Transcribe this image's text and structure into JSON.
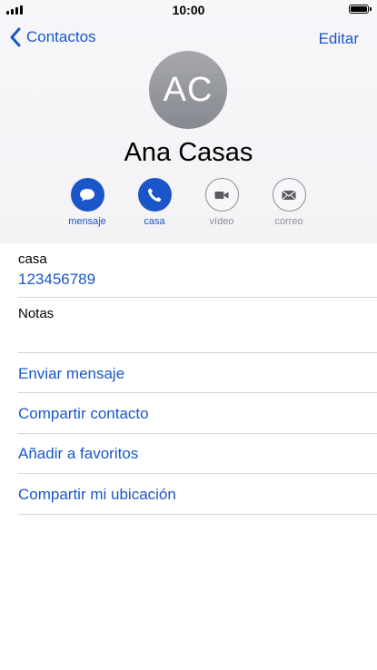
{
  "status_bar": {
    "time": "10:00"
  },
  "nav": {
    "back_label": "Contactos",
    "edit_label": "Editar"
  },
  "contact": {
    "initials": "AC",
    "name": "Ana Casas"
  },
  "actions": [
    {
      "label": "mensaje",
      "icon": "message-icon",
      "enabled": true
    },
    {
      "label": "casa",
      "icon": "phone-icon",
      "enabled": true
    },
    {
      "label": "vídeo",
      "icon": "video-icon",
      "enabled": false
    },
    {
      "label": "correo",
      "icon": "mail-icon",
      "enabled": false
    }
  ],
  "phone": {
    "label": "casa",
    "number": "123456789"
  },
  "notes": {
    "label": "Notas"
  },
  "links": [
    "Enviar mensaje",
    "Compartir contacto",
    "Añadir a favoritos",
    "Compartir mi ubicación"
  ],
  "colors": {
    "accent": "#1b56c9",
    "disabled": "#8e8e93",
    "separator": "#d6d6da"
  }
}
